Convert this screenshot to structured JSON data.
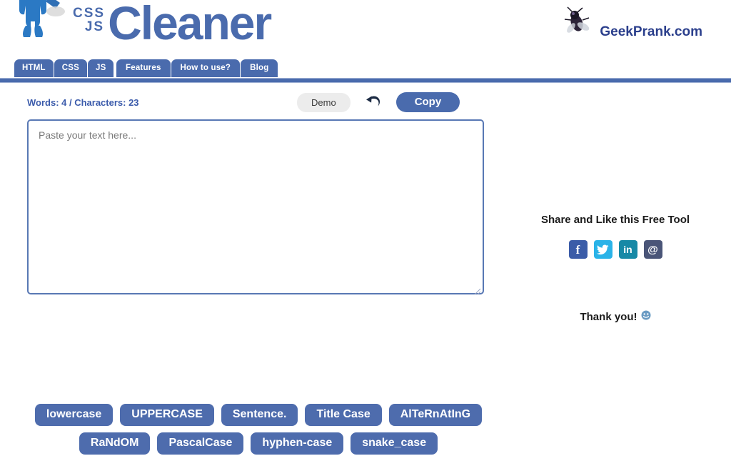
{
  "header": {
    "logo": {
      "mascot_icon": "cleaner-mascot-icon",
      "css_label": "CSS",
      "js_label": "JS",
      "name": "Cleaner"
    },
    "partner": {
      "fly_icon": "fly-icon",
      "label": "GeekPrank.com"
    }
  },
  "nav": {
    "primary_tabs": [
      {
        "label": "HTML"
      },
      {
        "label": "CSS"
      },
      {
        "label": "JS"
      }
    ],
    "secondary_tabs": [
      {
        "label": "Features"
      },
      {
        "label": "How to use?"
      },
      {
        "label": "Blog"
      }
    ]
  },
  "editor": {
    "counter": "Words: 4 / Characters: 23",
    "words": 4,
    "characters": 23,
    "demo_label": "Demo",
    "undo_icon": "undo-arrow-icon",
    "copy_label": "Copy",
    "textarea_placeholder": "Paste your text here...",
    "textarea_value": "",
    "resize_grip_icon": "resize-grip-icon"
  },
  "case_buttons": {
    "row1": [
      {
        "label": "lowercase"
      },
      {
        "label": "UPPERCASE"
      },
      {
        "label": "Sentence."
      },
      {
        "label": "Title Case"
      },
      {
        "label": "AlTeRnAtInG"
      }
    ],
    "row2": [
      {
        "label": "RaNdOM"
      },
      {
        "label": "PascalCase"
      },
      {
        "label": "hyphen-case"
      },
      {
        "label": "snake_case"
      }
    ]
  },
  "sidebar": {
    "share_title": "Share and Like this Free Tool",
    "social": [
      {
        "name": "facebook-icon",
        "glyph": "f",
        "color": "#3b5ca8"
      },
      {
        "name": "twitter-icon",
        "glyph": "ᴠ",
        "color": "#2ab3e8"
      },
      {
        "name": "linkedin-icon",
        "glyph": "in",
        "color": "#1789a6"
      },
      {
        "name": "email-icon",
        "glyph": "@",
        "color": "#4a5578"
      }
    ],
    "thanks_text": "Thank you!",
    "thanks_emoji": "☺"
  },
  "colors": {
    "brand_blue": "#4a6bad",
    "nav_blue": "#4a6bad",
    "accent_text": "#3b5bab",
    "button_blue": "#4e6cad",
    "demo_gray": "#ececec"
  }
}
